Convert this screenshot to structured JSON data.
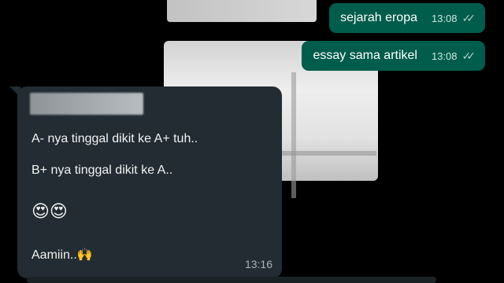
{
  "messages_out": [
    {
      "text": "sejarah eropa",
      "time": "13:08",
      "status": "✓✓"
    },
    {
      "text": "essay sama artikel",
      "time": "13:08",
      "status": "✓✓"
    }
  ],
  "message_in": {
    "lines": [
      "A- nya tinggal dikit ke A+ tuh..",
      "B+ nya tinggal dikit ke A..",
      "😍😍",
      "Aamiin..🙌"
    ],
    "time": "13:16"
  },
  "colors": {
    "outgoing_bubble": "#005c4b",
    "incoming_bubble": "#222c32",
    "background": "#000000"
  }
}
